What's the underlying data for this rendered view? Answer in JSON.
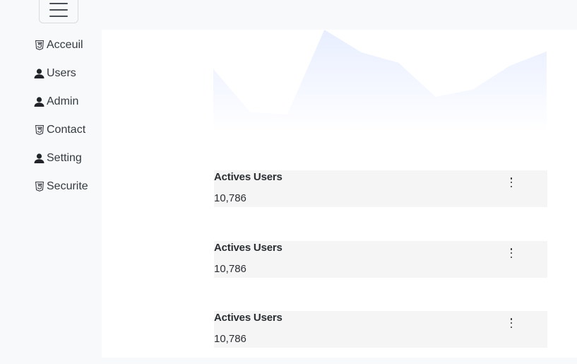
{
  "header": {
    "menu_icon": "hamburger-menu-icon"
  },
  "sidebar": {
    "items": [
      {
        "label": "Acceuil",
        "icon": "html5-icon"
      },
      {
        "label": "Users",
        "icon": "person-icon"
      },
      {
        "label": "Admin",
        "icon": "person-icon"
      },
      {
        "label": "Contact",
        "icon": "html5-icon"
      },
      {
        "label": "Setting",
        "icon": "person-icon"
      },
      {
        "label": "Securite",
        "icon": "html5-icon"
      }
    ]
  },
  "main": {
    "chart": {
      "type": "area",
      "fill_color": "#e8eeff",
      "values": [
        62,
        20,
        18,
        100,
        78,
        68,
        35,
        42,
        65,
        79
      ]
    },
    "cards": [
      {
        "title": "Actives Users",
        "value": "10,786",
        "menu_icon": "kebab-menu-icon"
      },
      {
        "title": "Actives Users",
        "value": "10,786",
        "menu_icon": "kebab-menu-icon"
      },
      {
        "title": "Actives Users",
        "value": "10,786",
        "menu_icon": "kebab-menu-icon"
      }
    ]
  },
  "colors": {
    "sidebar_bg": "#f8f9fa",
    "main_bg": "#ffffff",
    "card_bg": "#f5f5f5"
  }
}
